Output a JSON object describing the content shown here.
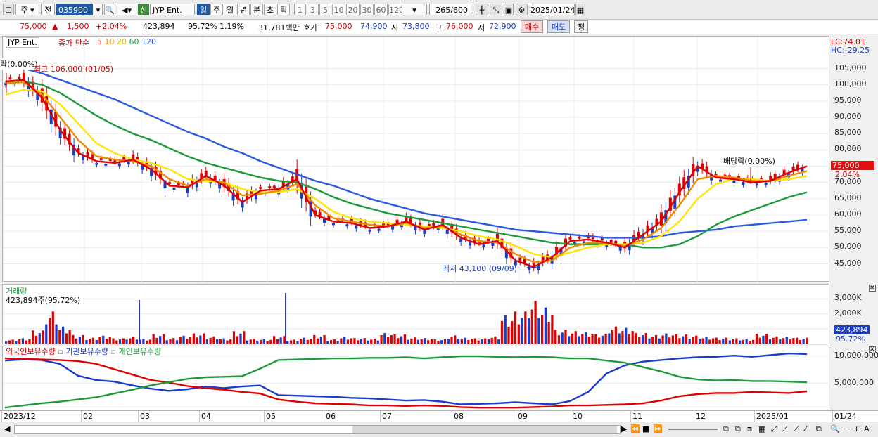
{
  "toolbar": {
    "type_selector": "주",
    "prev_label": "전",
    "code": "035900",
    "new_badge": "신",
    "stock_name": "JYP Ent.",
    "periods": [
      "일",
      "주",
      "월",
      "년",
      "분",
      "초",
      "틱"
    ],
    "ticks": [
      "1",
      "3",
      "5",
      "10",
      "20",
      "30",
      "60",
      "120"
    ],
    "count": "265",
    "total": "/600",
    "date": "2025/01/24"
  },
  "quote": {
    "price": "75,000",
    "up_mark": "▲",
    "change": "1,500",
    "change_pct": "+2.04%",
    "volume": "423,894",
    "vol_ratio": "95.72%",
    "turnover": "1.19%",
    "amount": "31,781백만",
    "ask_label": "호가",
    "ask": "75,000",
    "bid": "74,900",
    "open_label": "시",
    "open": "73,800",
    "high_label": "고",
    "high": "76,000",
    "low_label": "저",
    "low": "72,900",
    "buy_label": "매수",
    "sell_label": "매도",
    "avg_label": "평"
  },
  "price_panel": {
    "legend_name": "JYP Ent.",
    "legend_ma": "종가 단순",
    "ma_periods": [
      "5",
      "10",
      "20",
      "60",
      "120"
    ],
    "lc": "LC:74.01",
    "hc": "HC:-29.25",
    "ex_div_left": "락(0.00%)",
    "ex_div_right": "배당락(0.00%)",
    "max_note": "최고 106,000 (01/05)",
    "min_note": "최저 43,100 (09/09)",
    "y_ticks": [
      "105,000",
      "100,000",
      "95,000",
      "90,000",
      "85,000",
      "80,000",
      "70,000",
      "65,000",
      "60,000",
      "55,000",
      "50,000",
      "45,000"
    ],
    "current_price": "75,000",
    "current_pct": "2.04%"
  },
  "volume_panel": {
    "title": "거래량",
    "current": "423,894주(95.72%)",
    "y_ticks": [
      "3,000K",
      "2,000K",
      "1,000K"
    ],
    "current_tag": "423,894",
    "current_pct": "95.72%"
  },
  "holding_panel": {
    "legend": [
      "외국인보유수량",
      "기관보유수량",
      "개인보유수량"
    ],
    "y_ticks": [
      "10,000,000",
      "5,000,000"
    ]
  },
  "x_axis": [
    "2023/12",
    "02",
    "03",
    "04",
    "05",
    "06",
    "07",
    "08",
    "09",
    "10",
    "11",
    "12",
    "2025/01",
    "01/24"
  ],
  "colors": {
    "up": "#e00000",
    "down": "#1a3cc8",
    "ma5": "#e00000",
    "ma10": "#f08c00",
    "ma20": "#ffe600",
    "ma60": "#1e9a3c",
    "ma120": "#2a5ae0"
  },
  "chart_data": {
    "type": "line",
    "series": [
      {
        "name": "5",
        "values": [
          101000,
          101500,
          96000,
          86000,
          79000,
          76500,
          76000,
          77000,
          74000,
          69000,
          68500,
          72000,
          69000,
          64000,
          67500,
          68000,
          71000,
          60000,
          58000,
          57500,
          56000,
          56500,
          58000,
          55500,
          57000,
          53000,
          51000,
          52000,
          46000,
          44000,
          47000,
          52000,
          52500,
          51500,
          50000,
          54000,
          58000,
          67000,
          75000,
          71500,
          71000,
          70000,
          70500,
          73000,
          75000
        ]
      },
      {
        "name": "10",
        "values": [
          100500,
          100800,
          97000,
          90000,
          83000,
          78000,
          77000,
          76500,
          75000,
          71000,
          69000,
          71000,
          70000,
          66000,
          66500,
          67500,
          69500,
          63000,
          59000,
          58000,
          57000,
          56500,
          57500,
          56000,
          56500,
          54000,
          52000,
          51500,
          48000,
          45500,
          46000,
          50000,
          51500,
          51500,
          50500,
          52500,
          56000,
          63000,
          71000,
          72000,
          71500,
          70500,
          70500,
          72000,
          73500
        ]
      },
      {
        "name": "20",
        "values": [
          97000,
          98500,
          98000,
          94000,
          88000,
          82000,
          79000,
          77000,
          76000,
          74000,
          71000,
          70500,
          70000,
          68000,
          67000,
          67000,
          68000,
          65000,
          61000,
          59000,
          58000,
          57500,
          57000,
          56500,
          56000,
          55000,
          53500,
          52500,
          50500,
          48000,
          47000,
          48500,
          50000,
          51000,
          51000,
          51500,
          53500,
          58000,
          65000,
          69500,
          71000,
          71000,
          70500,
          71000,
          72000
        ]
      },
      {
        "name": "60",
        "values": [
          101000,
          101000,
          100000,
          97500,
          94000,
          90500,
          87500,
          85000,
          83000,
          80500,
          78000,
          76000,
          74500,
          73000,
          71500,
          70500,
          70000,
          68000,
          65500,
          63500,
          62000,
          60500,
          59500,
          58500,
          57500,
          56500,
          55500,
          54500,
          53500,
          52500,
          51500,
          51000,
          51000,
          51000,
          51000,
          50000,
          50000,
          51000,
          53500,
          57000,
          59500,
          61500,
          63500,
          65500,
          67000
        ]
      },
      {
        "name": "120",
        "values": [
          106000,
          105000,
          103500,
          101500,
          99500,
          97500,
          95500,
          93000,
          90500,
          88000,
          85500,
          83500,
          81000,
          79000,
          76500,
          74500,
          72500,
          70500,
          69000,
          67000,
          65000,
          63500,
          62000,
          60500,
          59500,
          58500,
          57500,
          56500,
          55500,
          55000,
          54500,
          54000,
          53500,
          53000,
          53000,
          53000,
          53500,
          54500,
          55000,
          55500,
          56500,
          57000,
          57500,
          58000,
          58500
        ]
      }
    ],
    "volume_k": [
      120,
      160,
      400,
      980,
      520,
      260,
      180,
      240,
      160,
      200,
      150,
      290,
      170,
      240,
      310,
      220,
      160,
      380,
      150,
      140,
      230,
      120,
      180,
      260,
      130,
      200,
      170,
      150,
      320,
      280,
      190,
      170,
      130,
      250,
      180,
      160,
      220,
      860,
      980,
      1300,
      1100,
      420,
      380,
      360,
      300,
      520,
      480,
      320,
      260,
      310,
      280,
      240,
      200,
      180,
      160,
      140,
      300,
      220,
      210,
      180
    ],
    "foreign_m": [
      9.2,
      9.4,
      9.3,
      8.6,
      6.4,
      5.6,
      5.3,
      4.6,
      4.0,
      3.6,
      3.9,
      4.4,
      4.1,
      4.4,
      4.6,
      2.8,
      2.7,
      2.6,
      2.5,
      2.3,
      2.2,
      2.0,
      1.8,
      1.9,
      1.6,
      1.1,
      1.2,
      1.3,
      1.5,
      1.3,
      1.1,
      1.7,
      3.4,
      6.8,
      8.3,
      9.0,
      9.3,
      9.6,
      9.8,
      9.9,
      10.1,
      9.9,
      10.2,
      10.5,
      10.4
    ],
    "inst_m": [
      9.6,
      9.5,
      9.4,
      9.3,
      9.1,
      8.6,
      7.6,
      6.6,
      5.6,
      5.1,
      4.5,
      4.1,
      3.8,
      3.4,
      3.1,
      2.0,
      1.6,
      1.3,
      1.2,
      1.1,
      0.9,
      0.9,
      0.8,
      0.9,
      0.8,
      0.6,
      0.5,
      0.5,
      0.5,
      0.6,
      0.7,
      0.9,
      0.9,
      1.0,
      1.1,
      1.3,
      1.8,
      2.6,
      3.0,
      3.2,
      3.2,
      3.4,
      3.3,
      3.2,
      3.5
    ],
    "retail_m": [
      0.5,
      0.9,
      1.3,
      1.6,
      2.0,
      2.4,
      3.1,
      3.8,
      4.6,
      5.2,
      5.8,
      6.1,
      6.2,
      6.3,
      7.7,
      9.3,
      9.4,
      9.5,
      9.6,
      9.6,
      9.7,
      9.7,
      9.8,
      9.6,
      9.8,
      10.0,
      10.0,
      9.9,
      9.8,
      9.9,
      9.8,
      9.6,
      9.6,
      9.2,
      8.8,
      8.0,
      7.2,
      6.2,
      5.7,
      5.5,
      5.6,
      5.4,
      5.4,
      5.3,
      5.2
    ]
  }
}
